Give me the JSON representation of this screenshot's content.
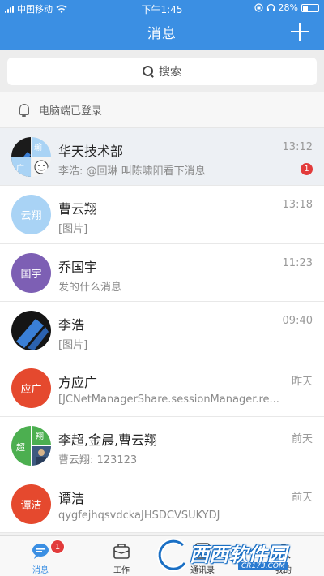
{
  "status_bar": {
    "carrier": "中国移动",
    "time": "下午1:45",
    "battery": "28%"
  },
  "nav": {
    "title": "消息"
  },
  "search": {
    "placeholder": "搜索"
  },
  "banner": {
    "text": "电脑端已登录"
  },
  "conversations": [
    {
      "name": "华天技术部",
      "preview": "李浩: @回琳 叫陈啸阳看下消息",
      "time": "13:12",
      "unread": "1",
      "avatar_tiles": [
        "瑜",
        "广"
      ]
    },
    {
      "name": "曹云翔",
      "preview": "[图片]",
      "time": "13:18",
      "avatar_text": "云翔",
      "avatar_color": "#a9d3f5"
    },
    {
      "name": "乔国宇",
      "preview": "发的什么消息",
      "time": "11:23",
      "avatar_text": "国宇",
      "avatar_color": "#7d5fb4"
    },
    {
      "name": "李浩",
      "preview": "[图片]",
      "time": "09:40"
    },
    {
      "name": "方应广",
      "preview": "[JCNetManagerShare.sessionManager.re...",
      "time": "昨天",
      "avatar_text": "应广",
      "avatar_color": "#e5492e"
    },
    {
      "name": "李超,金晨,曹云翔",
      "preview": "曹云翔: 123123",
      "time": "前天",
      "avatar_tiles": [
        "超",
        "翔"
      ]
    },
    {
      "name": "谭洁",
      "preview": "qygfejhqsvdckaJHSDCVSUKYDJ",
      "time": "前天",
      "avatar_text": "谭洁",
      "avatar_color": "#e5492e"
    }
  ],
  "tabbar": {
    "items": [
      {
        "label": "消息",
        "badge": "1"
      },
      {
        "label": "工作"
      },
      {
        "label": "通讯录"
      },
      {
        "label": "我的"
      }
    ]
  },
  "watermark": {
    "text": "西西软件园",
    "sub": "CR173.COM"
  },
  "colors": {
    "primary": "#3b8fe3",
    "badge": "#e23b3b"
  }
}
